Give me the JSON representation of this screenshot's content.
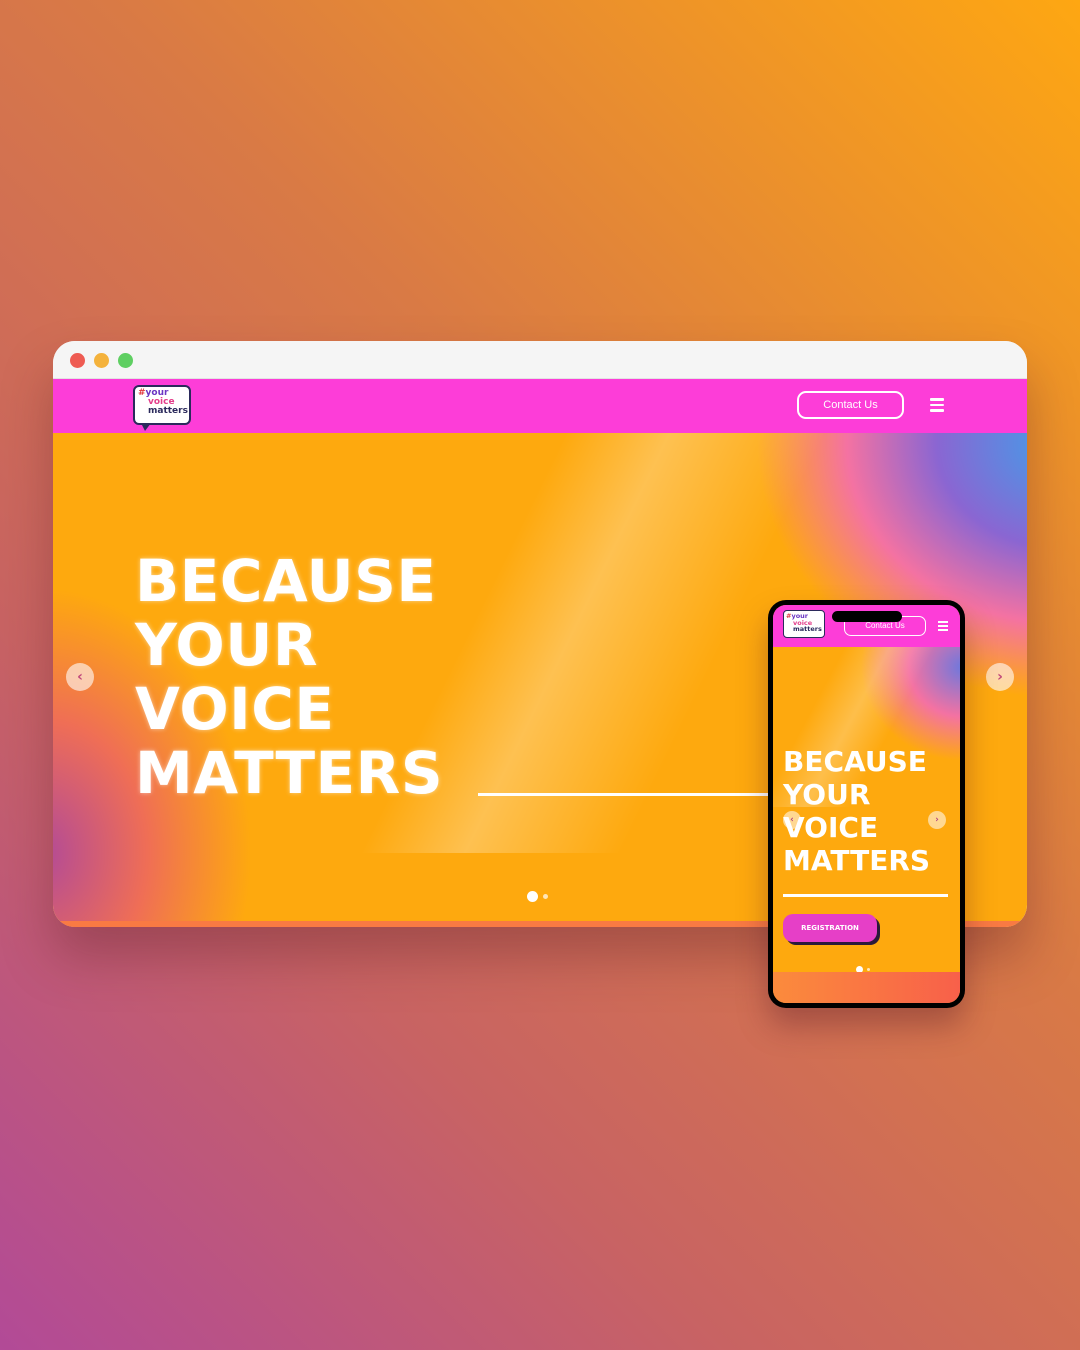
{
  "desktop": {
    "window_controls": [
      "close",
      "minimize",
      "maximize"
    ],
    "nav": {
      "logo": {
        "line1": "your",
        "line2": "voice",
        "line3": "matters",
        "hash": "#"
      },
      "contact_label": "Contact Us",
      "menu_icon": "hamburger-icon"
    },
    "hero": {
      "title_lines": [
        "BECAUSE",
        "YOUR",
        "VOICE",
        "MATTERS"
      ],
      "prev_icon": "chevron-left-icon",
      "next_icon": "chevron-right-icon",
      "prev_glyph": "‹",
      "next_glyph": "›",
      "slides_total": 2,
      "active_slide": 1
    }
  },
  "mobile": {
    "nav": {
      "logo": {
        "line1": "your",
        "line2": "voice",
        "line3": "matters",
        "hash": "#"
      },
      "contact_label": "Contact Us",
      "menu_icon": "hamburger-icon"
    },
    "hero": {
      "title_lines": [
        "BECAUSE",
        "YOUR",
        "VOICE",
        "MATTERS"
      ],
      "cta_label": "REGISTRATION",
      "prev_glyph": "‹",
      "next_glyph": "›",
      "slides_total": 2,
      "active_slide": 1
    }
  },
  "colors": {
    "nav_pink": "#fd3dd8",
    "hero_orange": "#fea90e",
    "cta_pink": "#e63fc7",
    "logo_navy": "#2b2a5c"
  }
}
